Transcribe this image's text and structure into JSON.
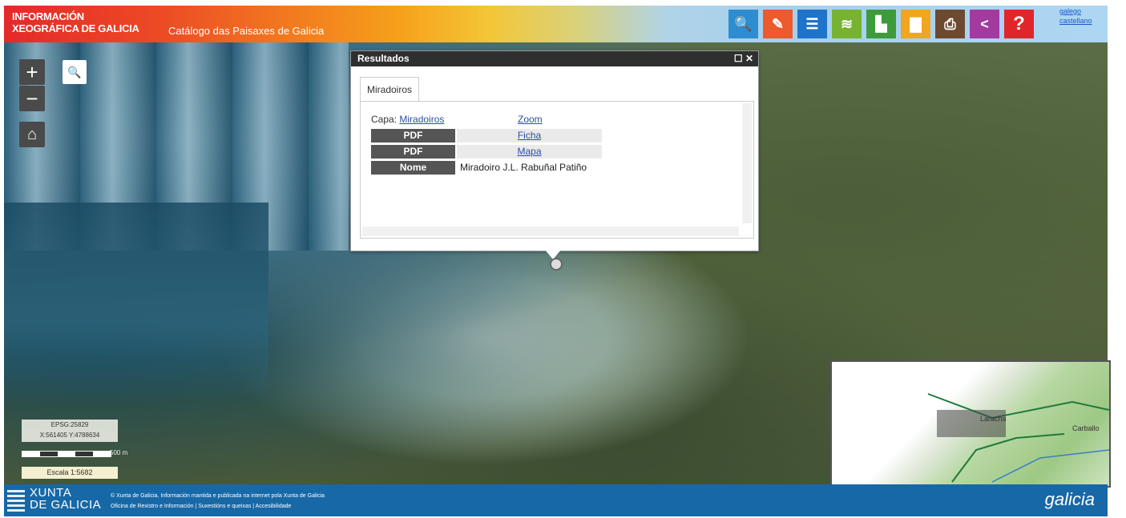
{
  "header": {
    "logo_line1": "INFORMACIÓN",
    "logo_line2": "XEOGRÁFICA DE GALICIA",
    "subtitle": "Catálogo das Paisaxes de Galicia",
    "lang_line1": "galego",
    "lang_line2": "castellano",
    "tools": [
      {
        "icon": "search-icon",
        "color": "#2e8dd1",
        "glyph": "🔍"
      },
      {
        "icon": "map-tool-icon",
        "color": "#ec5a2e",
        "glyph": "✎"
      },
      {
        "icon": "list-icon",
        "color": "#1f73c9",
        "glyph": "☰"
      },
      {
        "icon": "layers-icon",
        "color": "#78b231",
        "glyph": "≋"
      },
      {
        "icon": "legend-icon",
        "color": "#3e9b3b",
        "glyph": "▙"
      },
      {
        "icon": "save-icon",
        "color": "#f2a51e",
        "glyph": "▇"
      },
      {
        "icon": "print-icon",
        "color": "#6d4a2f",
        "glyph": "⎙"
      },
      {
        "icon": "share-icon",
        "color": "#a23aa0",
        "glyph": "<"
      },
      {
        "icon": "help-icon",
        "color": "#e0262a",
        "glyph": "?"
      }
    ]
  },
  "map_controls": {
    "zoom_in": "+",
    "zoom_out": "−",
    "search_glyph": "🔍",
    "home_glyph": "⌂"
  },
  "popup": {
    "title": "Resultados",
    "tab": "Miradoiros",
    "layer_label": "Capa:",
    "layer_link": "Miradoiros",
    "zoom_link": "Zoom",
    "rows": [
      {
        "label": "PDF",
        "value": "Ficha"
      },
      {
        "label": "PDF",
        "value": "Mapa"
      },
      {
        "label": "Nome",
        "value": "Miradoiro J.L. Rabuñal Patiño"
      }
    ]
  },
  "scale": {
    "line1": "EPSG:25829",
    "line2": "X:561405 Y:4788634",
    "bar_label": "500 m",
    "escala": "Escala 1:5682"
  },
  "overview": {
    "labels": [
      "Carballo",
      "Laracha"
    ]
  },
  "footer": {
    "brand_line1": "XUNTA",
    "brand_line2": "DE GALICIA",
    "text_line1": "© Xunta de Galicia. Información mantida e publicada na internet pola Xunta de Galicia",
    "text_line2": "Oficina de Rexistro e Información | Suxestións e queixas | Accesibilidade",
    "right_logo": "galicia"
  }
}
